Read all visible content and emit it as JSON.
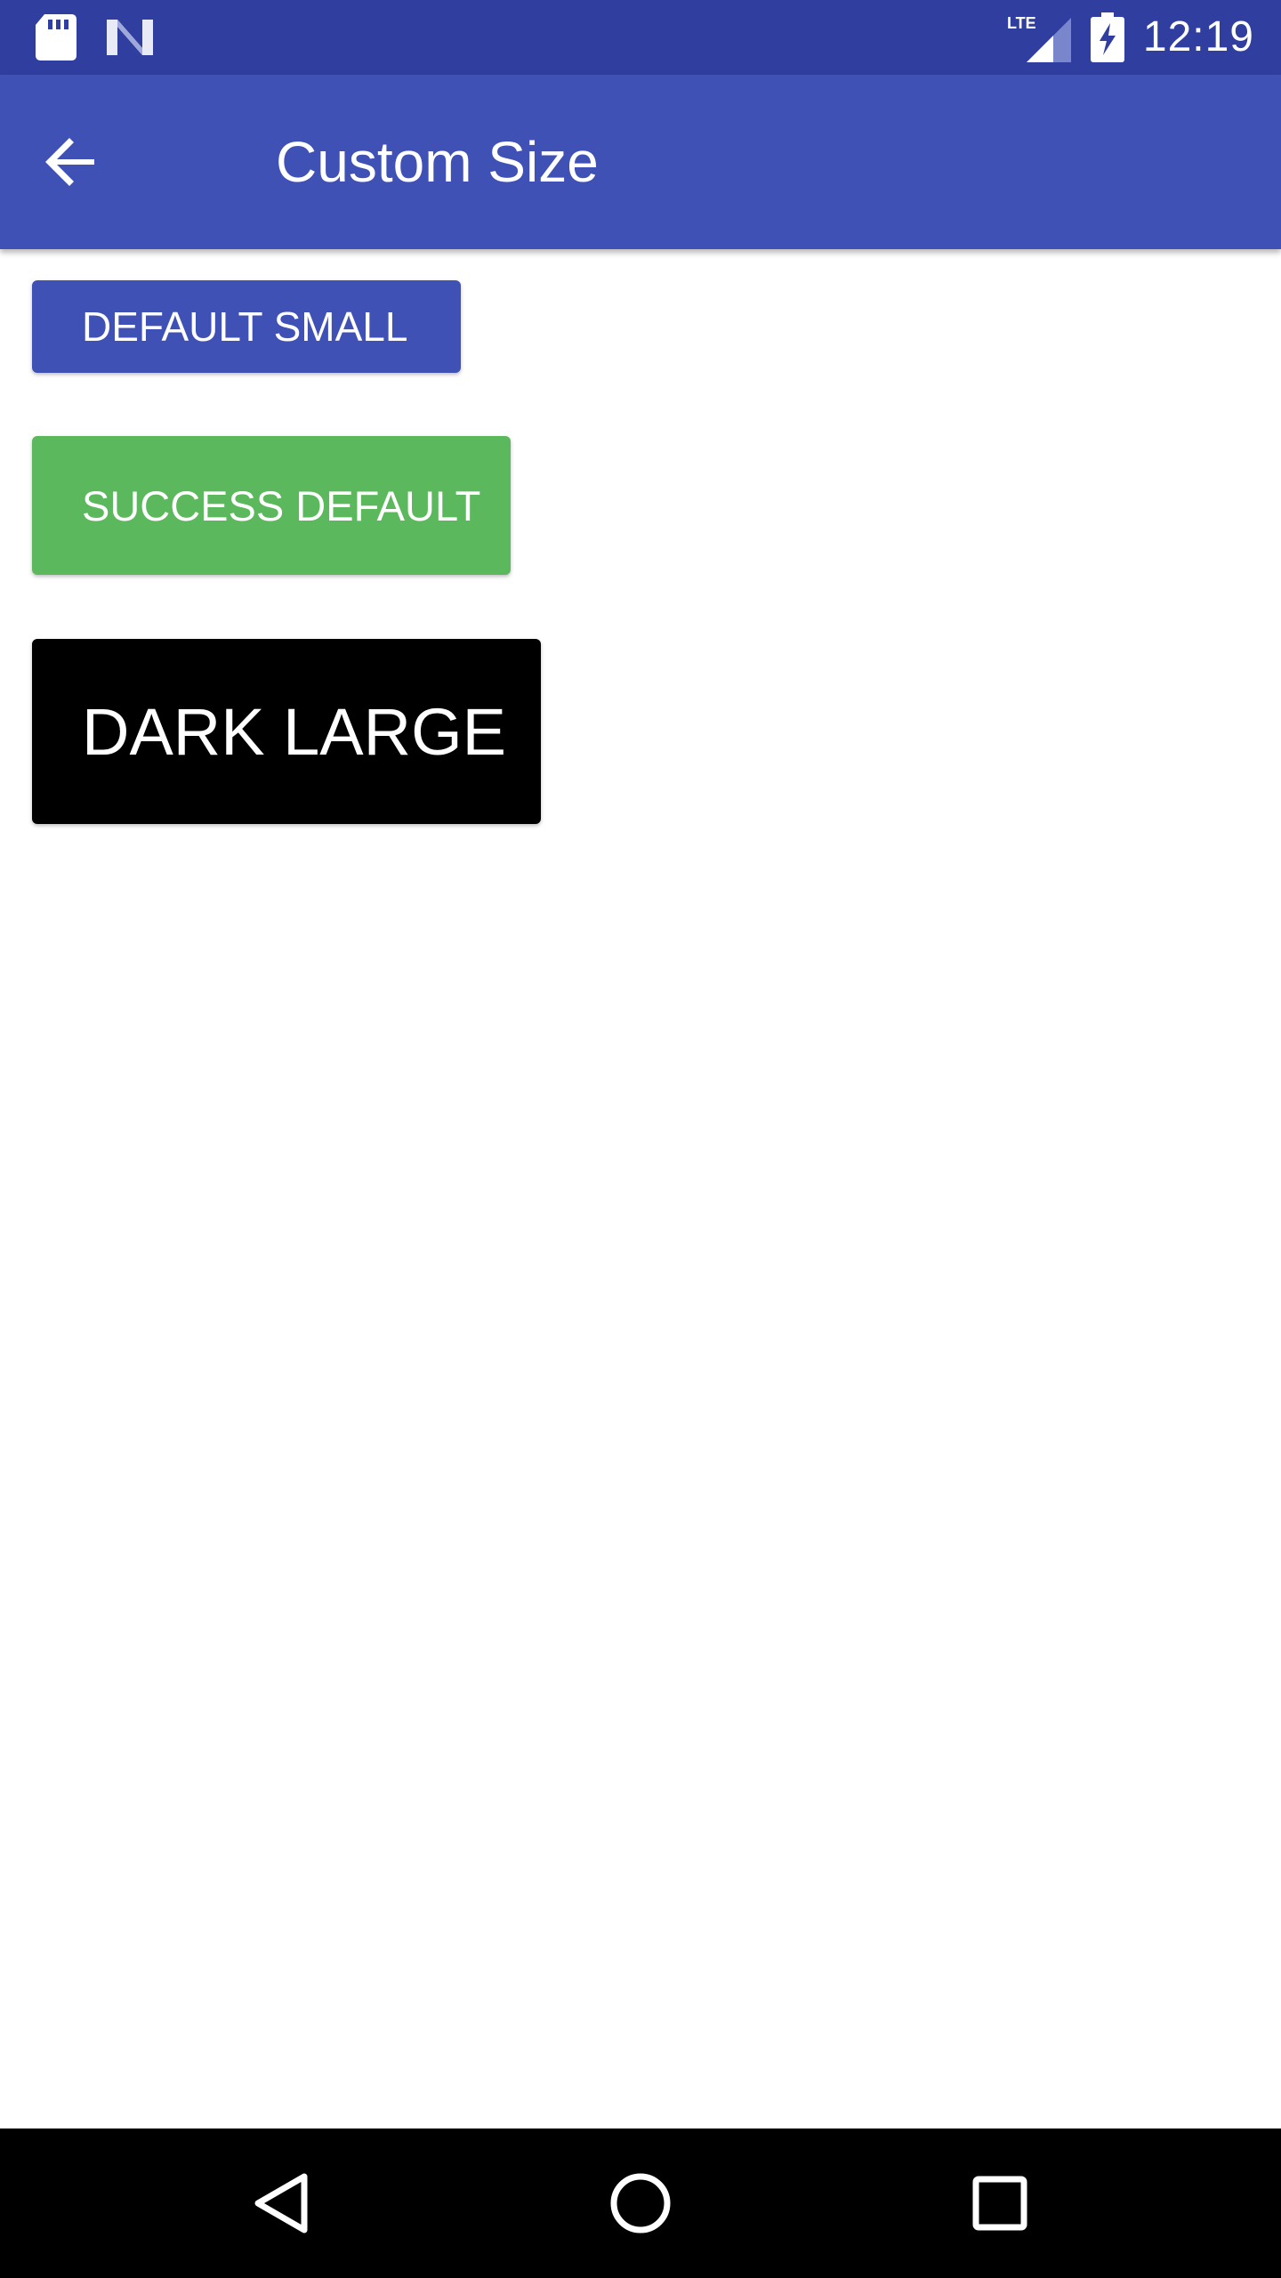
{
  "status_bar": {
    "time": "12:19",
    "network_label": "LTE",
    "icons": [
      "sd-card-icon",
      "n-logo-icon",
      "lte-signal-icon",
      "battery-charging-icon"
    ]
  },
  "app_bar": {
    "title": "Custom Size",
    "back_icon": "arrow-back-icon"
  },
  "buttons": [
    {
      "label": "DEFAULT SMALL",
      "color": "#3F51B5",
      "size": "small"
    },
    {
      "label": "SUCCESS DEFAULT",
      "color": "#5CB85C",
      "size": "default"
    },
    {
      "label": "DARK LARGE",
      "color": "#000000",
      "size": "large"
    }
  ],
  "nav_bar": {
    "icons": [
      "nav-back-icon",
      "nav-home-icon",
      "nav-recents-icon"
    ]
  },
  "colors": {
    "status_bar": "#303F9F",
    "app_bar": "#3F51B5",
    "background": "#FFFFFF",
    "nav_bar": "#000000"
  }
}
